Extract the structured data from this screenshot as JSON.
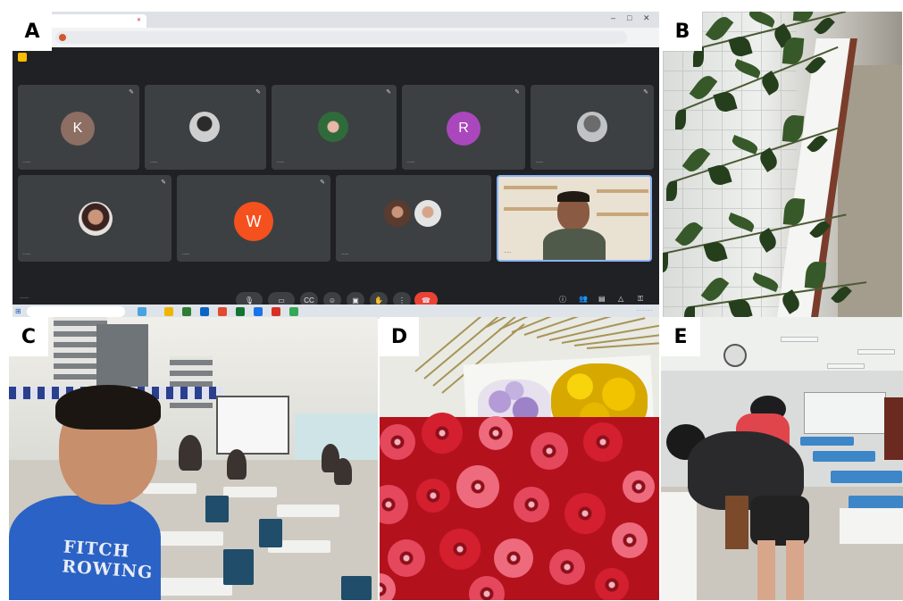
{
  "panels": {
    "a": {
      "label": "A"
    },
    "b": {
      "label": "B"
    },
    "c": {
      "label": "C"
    },
    "d": {
      "label": "D"
    },
    "e": {
      "label": "E"
    }
  },
  "call": {
    "tiles": [
      {
        "initial": "K",
        "color": "#8d6e63"
      },
      {
        "initial": "",
        "color": ""
      },
      {
        "initial": "",
        "color": ""
      },
      {
        "initial": "R",
        "color": "#ab47bc"
      },
      {
        "initial": "",
        "color": ""
      },
      {
        "initial": "",
        "color": ""
      },
      {
        "initial": "W",
        "color": "#f4511e"
      },
      {
        "initial": "",
        "color": ""
      },
      {
        "initial": "",
        "color": ""
      }
    ],
    "hangup_color": "#ea4335",
    "active_border_color": "#8ab4f8"
  },
  "shirt": {
    "line1": "FITCH",
    "line2": "ROWING"
  }
}
